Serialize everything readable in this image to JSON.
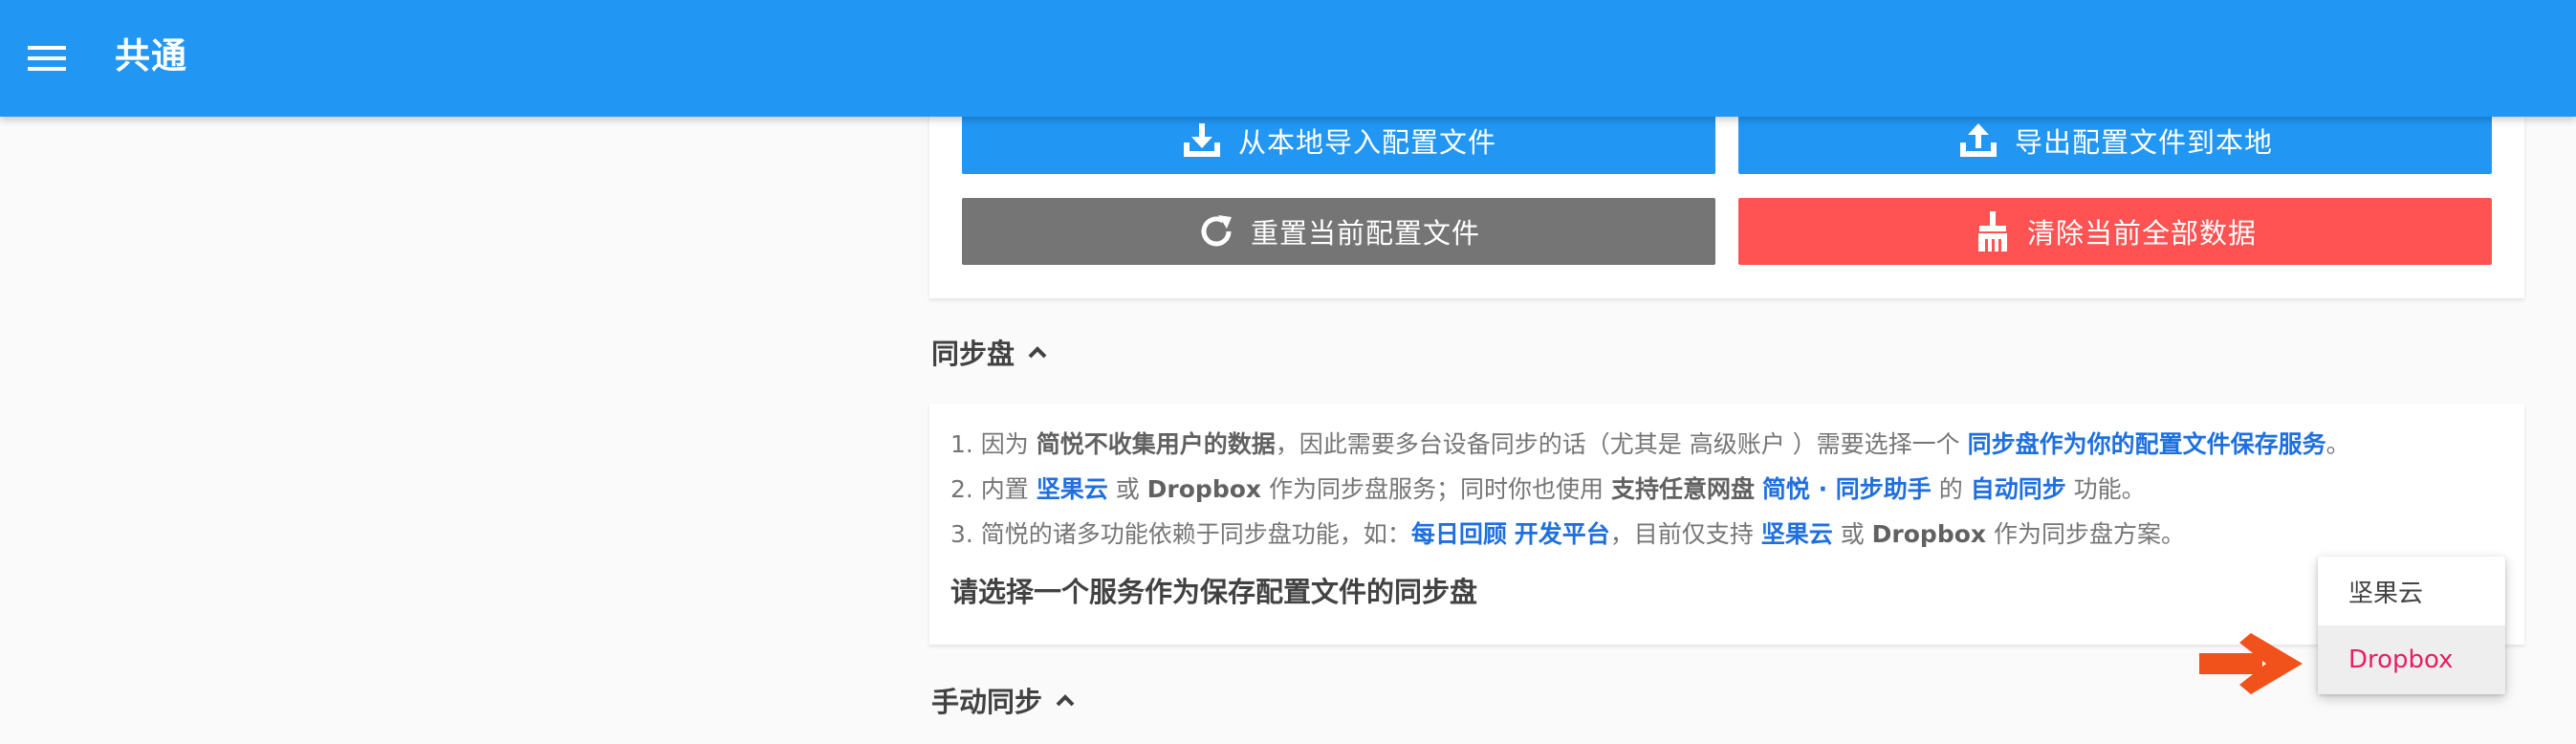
{
  "appbar": {
    "title": "共通",
    "menu_icon": "menu-icon",
    "color": "#2196f3"
  },
  "actions": {
    "import_label": "从本地导入配置文件",
    "export_label": "导出配置文件到本地",
    "reset_label": "重置当前配置文件",
    "clear_label": "清除当前全部数据",
    "colors": {
      "primary": "#2196f3",
      "grey": "#757575",
      "danger": "#ff5252"
    }
  },
  "sync_section": {
    "title": "同步盘",
    "lines": [
      {
        "prefix": "1. 因为 ",
        "bold1": "简悦不收集用户的数据",
        "mid": "，因此需要多台设备同步的话（尤其是 高级账户 ）需要选择一个 ",
        "link1": "同步盘作为你的配置文件保存服务",
        "suffix": "。"
      },
      {
        "prefix": "2. 内置 ",
        "link1": "坚果云",
        "t1": " 或 ",
        "bold1": "Dropbox",
        "t2": " 作为同步盘服务；同时你也使用 ",
        "bold2": "支持任意网盘",
        "t3": " ",
        "link2": "简悦 · 同步助手",
        "t4": " 的 ",
        "link3": "自动同步",
        "suffix": " 功能。"
      },
      {
        "prefix": "3. 简悦的诸多功能依赖于同步盘功能，如：",
        "link1": "每日回顾",
        "t1": " ",
        "link2": "开发平台",
        "t2": "，目前仅支持 ",
        "link3": "坚果云",
        "t3": " 或 ",
        "bold1": "Dropbox",
        "suffix": " 作为同步盘方案。"
      }
    ],
    "prompt": "请选择一个服务作为保存配置文件的同步盘",
    "options": [
      "坚果云",
      "Dropbox"
    ],
    "highlighted_option": "Dropbox"
  },
  "manual_section": {
    "title": "手动同步"
  }
}
